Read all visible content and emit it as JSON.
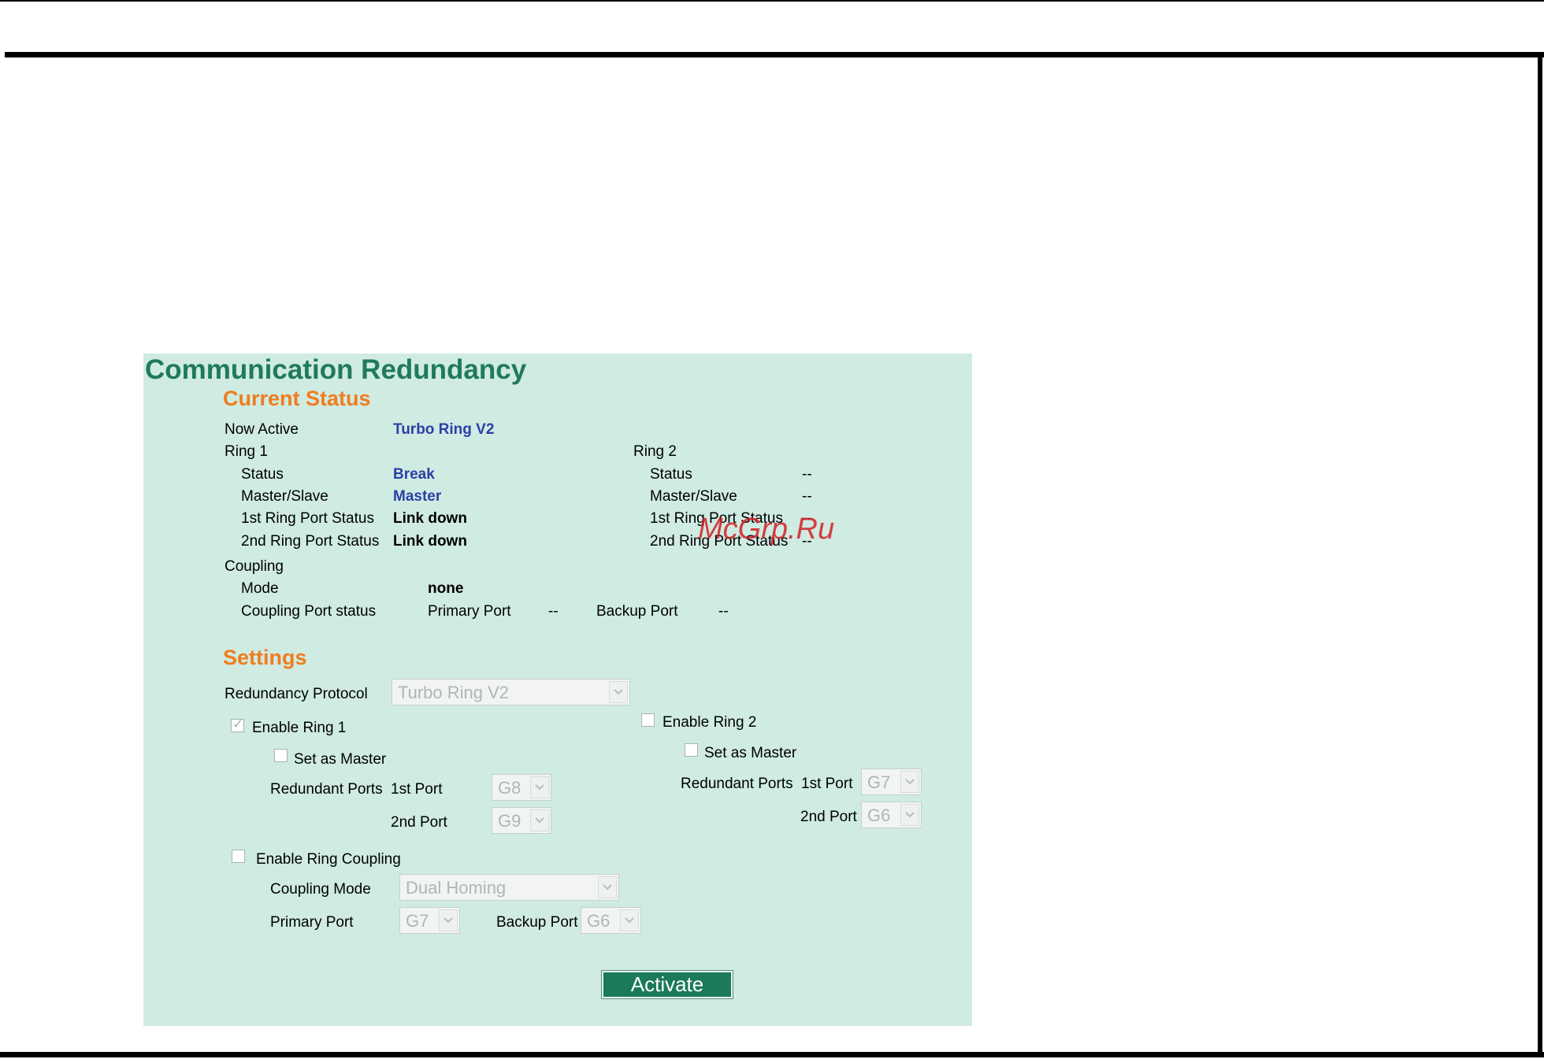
{
  "page": {
    "title": "Communication Redundancy",
    "watermark": "McGrp.Ru"
  },
  "current_status": {
    "heading": "Current Status",
    "now_active_label": "Now Active",
    "now_active_value": "Turbo Ring V2",
    "ring1": {
      "heading": "Ring 1",
      "status_label": "Status",
      "status_value": "Break",
      "master_slave_label": "Master/Slave",
      "master_slave_value": "Master",
      "port1_label": "1st Ring Port Status",
      "port1_value": "Link down",
      "port2_label": "2nd Ring Port Status",
      "port2_value": "Link down"
    },
    "ring2": {
      "heading": "Ring 2",
      "status_label": "Status",
      "status_value": "--",
      "master_slave_label": "Master/Slave",
      "master_slave_value": "--",
      "port1_label": "1st Ring Port Status",
      "port1_value": "--",
      "port2_label": "2nd Ring Port Status",
      "port2_value": "--"
    },
    "coupling": {
      "heading": "Coupling",
      "mode_label": "Mode",
      "mode_value": "none",
      "port_status_label": "Coupling Port status",
      "primary_label": "Primary Port",
      "primary_value": "--",
      "backup_label": "Backup Port",
      "backup_value": "--"
    }
  },
  "settings": {
    "heading": "Settings",
    "protocol_label": "Redundancy Protocol",
    "protocol_value": "Turbo Ring V2",
    "ring1": {
      "enable_label": "Enable Ring 1",
      "enabled": true,
      "master_label": "Set as Master",
      "master_checked": false,
      "redundant_label": "Redundant Ports",
      "port1_label": "1st Port",
      "port1_value": "G8",
      "port2_label": "2nd Port",
      "port2_value": "G9"
    },
    "ring2": {
      "enable_label": "Enable Ring 2",
      "enabled": false,
      "master_label": "Set as Master",
      "master_checked": false,
      "redundant_label": "Redundant Ports",
      "port1_label": "1st Port",
      "port1_value": "G7",
      "port2_label": "2nd Port",
      "port2_value": "G6"
    },
    "coupling": {
      "enable_label": "Enable Ring Coupling",
      "enabled": false,
      "mode_label": "Coupling Mode",
      "mode_value": "Dual Homing",
      "primary_label": "Primary Port",
      "primary_value": "G7",
      "backup_label": "Backup Port",
      "backup_value": "G6"
    },
    "activate_label": "Activate"
  },
  "colors": {
    "panel_bg": "#cfebe2",
    "title": "#1f7a5c",
    "section_heading": "#f07d1e",
    "status_value": "#2c3fa6",
    "button_bg": "#1a7a59",
    "watermark": "#d41f26"
  },
  "icons": {
    "checkmark": "check-icon",
    "dropdown": "chevron-down-icon"
  }
}
